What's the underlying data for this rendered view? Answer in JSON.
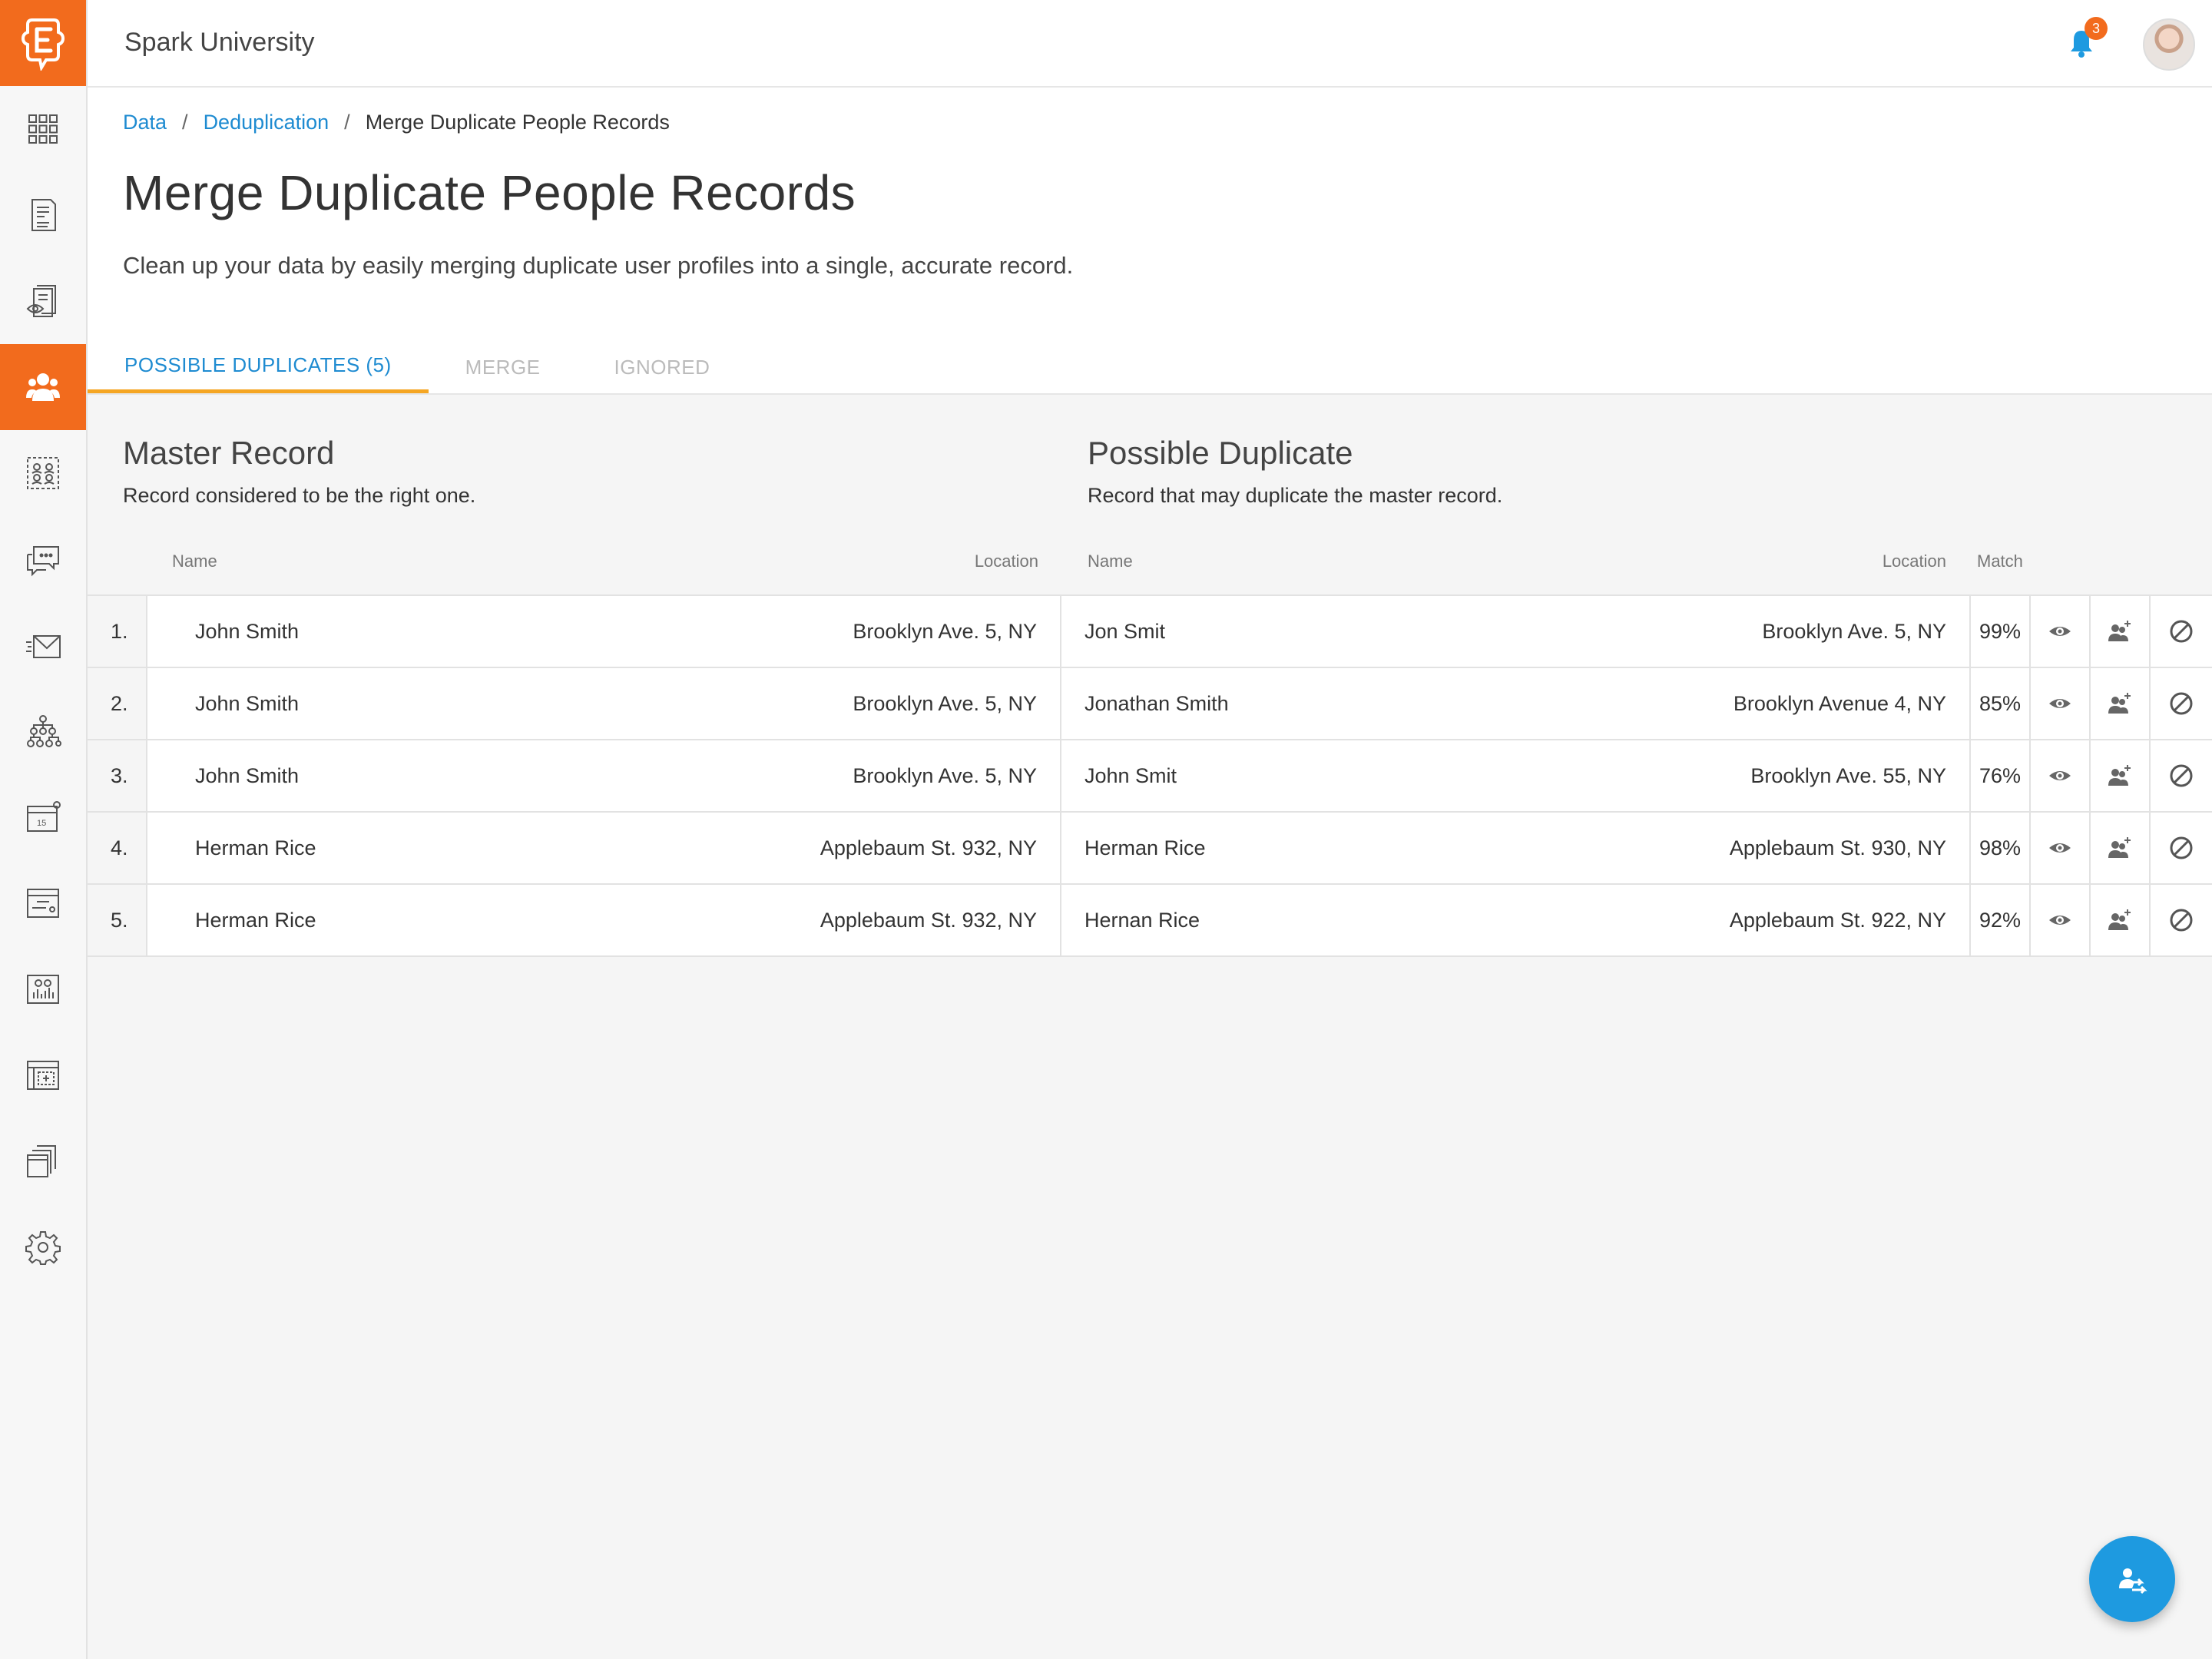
{
  "app": {
    "title": "Spark University"
  },
  "header": {
    "notification_count": "3"
  },
  "breadcrumb": [
    "Data",
    "Deduplication",
    "Merge Duplicate People Records"
  ],
  "page": {
    "title": "Merge Duplicate People Records",
    "subtitle": "Clean up your data by easily merging duplicate user profiles into a single, accurate record."
  },
  "tabs": [
    {
      "label": "POSSIBLE DUPLICATES (5)",
      "active": true
    },
    {
      "label": "MERGE",
      "active": false
    },
    {
      "label": "IGNORED",
      "active": false
    }
  ],
  "master": {
    "title": "Master Record",
    "desc": "Record considered to be the right one.",
    "col_name": "Name",
    "col_location": "Location"
  },
  "duplicate": {
    "title": "Possible Duplicate",
    "desc": "Record that may duplicate the master record.",
    "col_name": "Name",
    "col_location": "Location",
    "col_match": "Match"
  },
  "rows": [
    {
      "idx": "1.",
      "master_name": "John Smith",
      "master_loc": "Brooklyn Ave. 5, NY",
      "dup_name": "Jon Smit",
      "dup_loc": "Brooklyn Ave. 5, NY",
      "match": "99%"
    },
    {
      "idx": "2.",
      "master_name": "John Smith",
      "master_loc": "Brooklyn Ave. 5, NY",
      "dup_name": "Jonathan Smith",
      "dup_loc": "Brooklyn Avenue 4, NY",
      "match": "85%"
    },
    {
      "idx": "3.",
      "master_name": "John Smith",
      "master_loc": "Brooklyn Ave. 5, NY",
      "dup_name": "John Smit",
      "dup_loc": "Brooklyn Ave. 55, NY",
      "match": "76%"
    },
    {
      "idx": "4.",
      "master_name": "Herman Rice",
      "master_loc": "Applebaum St. 932, NY",
      "dup_name": "Herman Rice",
      "dup_loc": "Applebaum St. 930, NY",
      "match": "98%"
    },
    {
      "idx": "5.",
      "master_name": "Herman Rice",
      "master_loc": "Applebaum St. 932, NY",
      "dup_name": "Hernan Rice",
      "dup_loc": "Applebaum St. 922, NY",
      "match": "92%"
    }
  ],
  "icons": {
    "logo": "logo-e-icon",
    "nav": [
      "grid-icon",
      "document-icon",
      "review-icon",
      "people-icon",
      "groups-icon",
      "chat-icon",
      "mail-icon",
      "hierarchy-icon",
      "calendar-icon",
      "form-icon",
      "analytics-icon",
      "layout-icon",
      "files-icon",
      "gear-icon"
    ],
    "row_actions": [
      "eye-icon",
      "merge-person-icon",
      "ignore-icon"
    ]
  },
  "colors": {
    "brand": "#f26b1d",
    "link": "#1e8bd1",
    "tab_underline": "#f5a623",
    "fab": "#1e9ae0"
  }
}
